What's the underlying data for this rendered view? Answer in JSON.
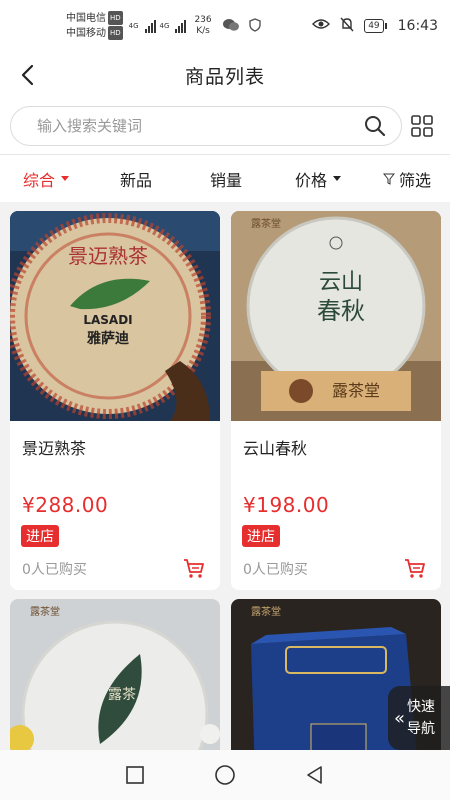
{
  "status": {
    "carrier1": "中国电信",
    "carrier2": "中国移动",
    "hd": "HD",
    "net": "4G",
    "speed_value": "236",
    "speed_unit": "K/s",
    "battery": "49",
    "time": "16:43"
  },
  "header": {
    "title": "商品列表"
  },
  "search": {
    "placeholder": "输入搜索关键词"
  },
  "sort": {
    "items": [
      "综合",
      "新品",
      "销量",
      "价格",
      "筛选"
    ],
    "active": "综合"
  },
  "products": [
    {
      "name": "景迈熟茶",
      "price": "¥288.00",
      "badge": "进店",
      "buyers": "0人已购买",
      "image": "puer-cake-lasadi"
    },
    {
      "name": "云山春秋",
      "price": "¥198.00",
      "badge": "进店",
      "buyers": "0人已购买",
      "image": "puer-cake-yunshan"
    },
    {
      "name": "",
      "price": "",
      "badge": "",
      "buyers": "",
      "image": "puer-cake-leaf"
    },
    {
      "name": "",
      "price": "",
      "badge": "",
      "buyers": "",
      "image": "blue-tea-box"
    }
  ],
  "quicknav": {
    "line1": "快速",
    "line2": "导航"
  },
  "colors": {
    "accent": "#e62e2e",
    "muted": "#999999"
  }
}
